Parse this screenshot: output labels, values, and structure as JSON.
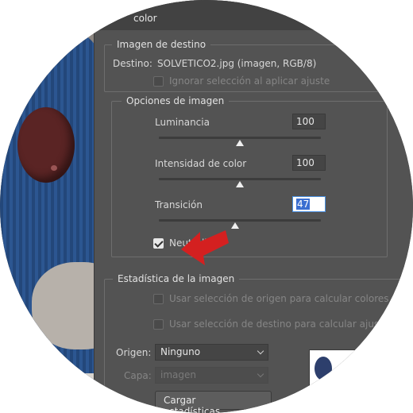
{
  "dialog": {
    "title": "color"
  },
  "destination": {
    "legend": "Imagen de destino",
    "label": "Destino:",
    "value": "SOLVETICO2.jpg (imagen, RGB/8)",
    "ignore_selection": "Ignorar selección al aplicar ajuste"
  },
  "image_options": {
    "legend": "Opciones de imagen",
    "luminance": {
      "label": "Luminancia",
      "value": "100",
      "level": 100
    },
    "color_intensity": {
      "label": "Intensidad de color",
      "value": "100",
      "level": 100
    },
    "fade": {
      "label": "Transición",
      "value": "47",
      "level": 47
    },
    "neutralize": {
      "label": "Neutralizar",
      "checked": true
    }
  },
  "statistics": {
    "legend": "Estadística de la imagen",
    "use_source_selection": "Usar selección de origen para calcular colores",
    "use_target_selection": "Usar selección de destino para calcular ajuste",
    "source_label": "Origen:",
    "source_value": "Ninguno",
    "layer_label": "Capa:",
    "layer_value": "imagen",
    "load_button": "Cargar estadísticas..."
  },
  "colors": {
    "dialog_bg": "#535353",
    "accent_arrow": "#d42020",
    "focus": "#4a90e2"
  }
}
